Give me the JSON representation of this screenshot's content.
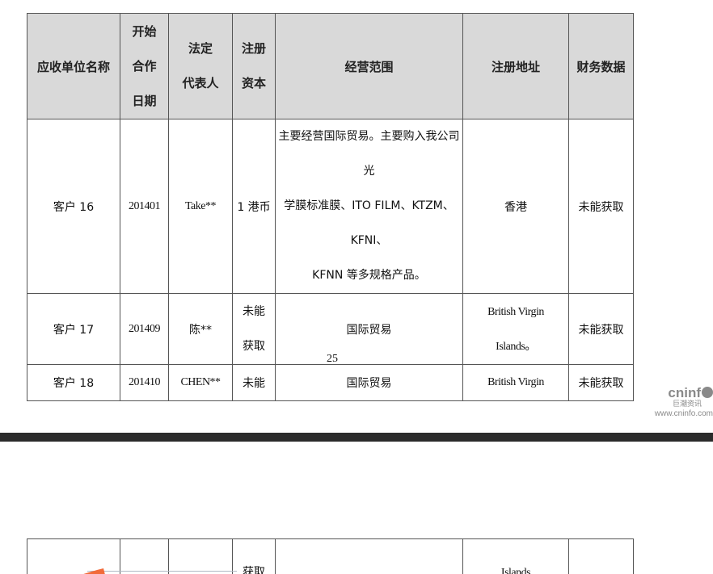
{
  "table": {
    "headers": {
      "name": "应收单位名称",
      "start_date": [
        "开始",
        "合作",
        "日期"
      ],
      "legal_rep": [
        "法定",
        "代表人"
      ],
      "reg_capital": [
        "注册",
        "资本"
      ],
      "scope": "经营范围",
      "reg_address": "注册地址",
      "financials": "财务数据"
    },
    "rows": [
      {
        "name": "客户 16",
        "start_date": "201401",
        "legal_rep": "Take**",
        "reg_capital": [
          "1 港币"
        ],
        "scope": [
          "主要经营国际贸易。主要购入我公司光",
          "学膜标准膜、ITO FILM、KTZM、KFNI、",
          "KFNN 等多规格产品。"
        ],
        "reg_address": [
          "香港"
        ],
        "financials": "未能获取"
      },
      {
        "name": "客户 17",
        "start_date": "201409",
        "legal_rep": "陈**",
        "reg_capital": [
          "未能",
          "获取"
        ],
        "scope": [
          "国际贸易"
        ],
        "reg_address": [
          "British Virgin",
          "Islands。"
        ],
        "financials": "未能获取"
      },
      {
        "name": "客户 18",
        "start_date": "201410",
        "legal_rep": "CHEN**",
        "reg_capital": [
          "未能"
        ],
        "scope": [
          "国际贸易"
        ],
        "reg_address": [
          "British Virgin"
        ],
        "financials": "未能获取"
      }
    ],
    "continuation": {
      "reg_capital": "获取",
      "reg_address": "Islands"
    }
  },
  "page_number": "25",
  "watermark": {
    "logo": "cninf",
    "cn": "巨潮资讯",
    "url": "www.cninfo.com"
  },
  "colors": {
    "header_bg": "#d9d9d9",
    "border": "#555555",
    "separator": "#2b2b2b",
    "cursor_accent": "#f26b3a",
    "watermark": "#8a8a8a"
  }
}
